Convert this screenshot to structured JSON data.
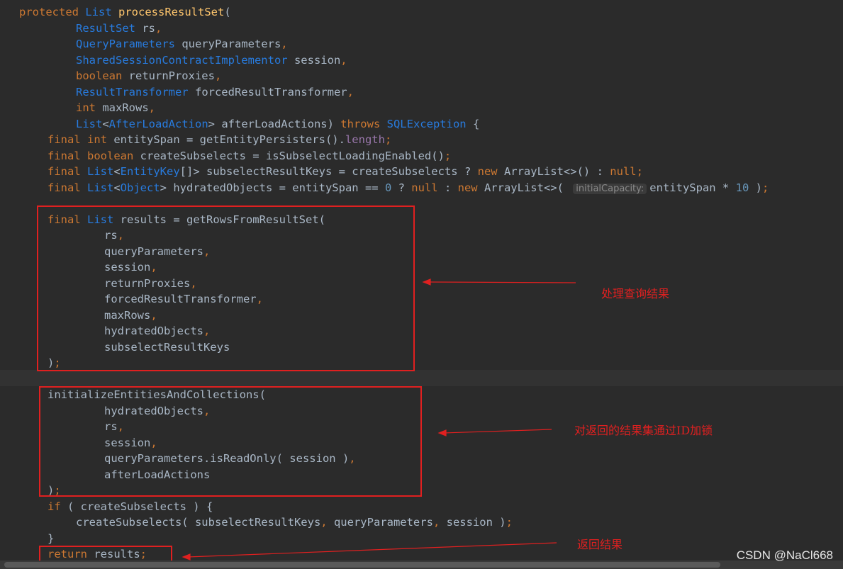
{
  "code": {
    "lines": [
      {
        "indent": 0,
        "tokens": [
          {
            "t": "protected ",
            "c": "kw"
          },
          {
            "t": "List ",
            "c": "ty"
          },
          {
            "t": "processResultSet",
            "c": "fn"
          },
          {
            "t": "(",
            "c": ""
          }
        ]
      },
      {
        "indent": 4,
        "tokens": [
          {
            "t": "ResultSet ",
            "c": "ty"
          },
          {
            "t": "rs",
            "c": ""
          },
          {
            "t": ",",
            "c": "kw"
          }
        ]
      },
      {
        "indent": 4,
        "tokens": [
          {
            "t": "QueryParameters ",
            "c": "ty"
          },
          {
            "t": "queryParameters",
            "c": ""
          },
          {
            "t": ",",
            "c": "kw"
          }
        ]
      },
      {
        "indent": 4,
        "tokens": [
          {
            "t": "SharedSessionContractImplementor ",
            "c": "ty"
          },
          {
            "t": "session",
            "c": ""
          },
          {
            "t": ",",
            "c": "kw"
          }
        ]
      },
      {
        "indent": 4,
        "tokens": [
          {
            "t": "boolean ",
            "c": "kw"
          },
          {
            "t": "returnProxies",
            "c": ""
          },
          {
            "t": ",",
            "c": "kw"
          }
        ]
      },
      {
        "indent": 4,
        "tokens": [
          {
            "t": "ResultTransformer ",
            "c": "ty"
          },
          {
            "t": "forcedResultTransformer",
            "c": ""
          },
          {
            "t": ",",
            "c": "kw"
          }
        ]
      },
      {
        "indent": 4,
        "tokens": [
          {
            "t": "int ",
            "c": "kw"
          },
          {
            "t": "maxRows",
            "c": ""
          },
          {
            "t": ",",
            "c": "kw"
          }
        ]
      },
      {
        "indent": 4,
        "tokens": [
          {
            "t": "List",
            "c": "ty"
          },
          {
            "t": "<",
            "c": ""
          },
          {
            "t": "AfterLoadAction",
            "c": "ty"
          },
          {
            "t": "> afterLoadActions) ",
            "c": ""
          },
          {
            "t": "throws ",
            "c": "kw"
          },
          {
            "t": "SQLException ",
            "c": "ty"
          },
          {
            "t": "{",
            "c": ""
          }
        ]
      },
      {
        "indent": 2,
        "tokens": [
          {
            "t": "final int ",
            "c": "kw"
          },
          {
            "t": "entitySpan = getEntityPersisters().",
            "c": ""
          },
          {
            "t": "length",
            "c": "fld"
          },
          {
            "t": ";",
            "c": "kw"
          }
        ]
      },
      {
        "indent": 2,
        "tokens": [
          {
            "t": "final boolean ",
            "c": "kw"
          },
          {
            "t": "createSubselects = isSubselectLoadingEnabled()",
            "c": ""
          },
          {
            "t": ";",
            "c": "kw"
          }
        ]
      },
      {
        "indent": 2,
        "tokens": [
          {
            "t": "final ",
            "c": "kw"
          },
          {
            "t": "List",
            "c": "ty"
          },
          {
            "t": "<",
            "c": ""
          },
          {
            "t": "EntityKey",
            "c": "ty"
          },
          {
            "t": "[]> subselectResultKeys = createSubselects ? ",
            "c": ""
          },
          {
            "t": "new ",
            "c": "kw"
          },
          {
            "t": "ArrayList<>() : ",
            "c": ""
          },
          {
            "t": "null",
            "c": "kw"
          },
          {
            "t": ";",
            "c": "kw"
          }
        ]
      },
      {
        "indent": 2,
        "tokens": [
          {
            "t": "final ",
            "c": "kw"
          },
          {
            "t": "List",
            "c": "ty"
          },
          {
            "t": "<",
            "c": ""
          },
          {
            "t": "Object",
            "c": "ty"
          },
          {
            "t": "> hydratedObjects = entitySpan == ",
            "c": ""
          },
          {
            "t": "0",
            "c": "num"
          },
          {
            "t": " ? ",
            "c": ""
          },
          {
            "t": "null",
            "c": "kw"
          },
          {
            "t": " : ",
            "c": ""
          },
          {
            "t": "new ",
            "c": "kw"
          },
          {
            "t": "ArrayList<>( ",
            "c": ""
          },
          {
            "t": "initialCapacity:",
            "c": "hint"
          },
          {
            "t": "entitySpan * ",
            "c": ""
          },
          {
            "t": "10",
            "c": "num"
          },
          {
            "t": " )",
            "c": ""
          },
          {
            "t": ";",
            "c": "kw"
          }
        ]
      },
      {
        "indent": 0,
        "tokens": []
      },
      {
        "indent": 2,
        "tokens": [
          {
            "t": "final ",
            "c": "kw"
          },
          {
            "t": "List ",
            "c": "ty"
          },
          {
            "t": "results = getRowsFromResultSet(",
            "c": ""
          }
        ]
      },
      {
        "indent": 6,
        "tokens": [
          {
            "t": "rs",
            "c": ""
          },
          {
            "t": ",",
            "c": "kw"
          }
        ]
      },
      {
        "indent": 6,
        "tokens": [
          {
            "t": "queryParameters",
            "c": ""
          },
          {
            "t": ",",
            "c": "kw"
          }
        ]
      },
      {
        "indent": 6,
        "tokens": [
          {
            "t": "session",
            "c": ""
          },
          {
            "t": ",",
            "c": "kw"
          }
        ]
      },
      {
        "indent": 6,
        "tokens": [
          {
            "t": "returnProxies",
            "c": ""
          },
          {
            "t": ",",
            "c": "kw"
          }
        ]
      },
      {
        "indent": 6,
        "tokens": [
          {
            "t": "forcedResultTransformer",
            "c": ""
          },
          {
            "t": ",",
            "c": "kw"
          }
        ]
      },
      {
        "indent": 6,
        "tokens": [
          {
            "t": "maxRows",
            "c": ""
          },
          {
            "t": ",",
            "c": "kw"
          }
        ]
      },
      {
        "indent": 6,
        "tokens": [
          {
            "t": "hydratedObjects",
            "c": ""
          },
          {
            "t": ",",
            "c": "kw"
          }
        ]
      },
      {
        "indent": 6,
        "tokens": [
          {
            "t": "subselectResultKeys",
            "c": ""
          }
        ]
      },
      {
        "indent": 2,
        "tokens": [
          {
            "t": ")",
            "c": ""
          },
          {
            "t": ";",
            "c": "kw"
          }
        ]
      },
      {
        "indent": 0,
        "tokens": []
      },
      {
        "indent": 2,
        "tokens": [
          {
            "t": "initializeEntitiesAndCollections(",
            "c": ""
          }
        ]
      },
      {
        "indent": 6,
        "tokens": [
          {
            "t": "hydratedObjects",
            "c": ""
          },
          {
            "t": ",",
            "c": "kw"
          }
        ]
      },
      {
        "indent": 6,
        "tokens": [
          {
            "t": "rs",
            "c": ""
          },
          {
            "t": ",",
            "c": "kw"
          }
        ]
      },
      {
        "indent": 6,
        "tokens": [
          {
            "t": "session",
            "c": ""
          },
          {
            "t": ",",
            "c": "kw"
          }
        ]
      },
      {
        "indent": 6,
        "tokens": [
          {
            "t": "queryParameters.isReadOnly( session )",
            "c": ""
          },
          {
            "t": ",",
            "c": "kw"
          }
        ]
      },
      {
        "indent": 6,
        "tokens": [
          {
            "t": "afterLoadActions",
            "c": ""
          }
        ]
      },
      {
        "indent": 2,
        "tokens": [
          {
            "t": ")",
            "c": ""
          },
          {
            "t": ";",
            "c": "kw"
          }
        ]
      },
      {
        "indent": 2,
        "tokens": [
          {
            "t": "if ",
            "c": "kw"
          },
          {
            "t": "( createSubselects ) {",
            "c": ""
          }
        ]
      },
      {
        "indent": 4,
        "tokens": [
          {
            "t": "createSubselects( subselectResultKeys",
            "c": ""
          },
          {
            "t": ", ",
            "c": "kw"
          },
          {
            "t": "queryParameters",
            "c": ""
          },
          {
            "t": ", ",
            "c": "kw"
          },
          {
            "t": "session )",
            "c": ""
          },
          {
            "t": ";",
            "c": "kw"
          }
        ]
      },
      {
        "indent": 2,
        "tokens": [
          {
            "t": "}",
            "c": ""
          }
        ]
      },
      {
        "indent": 2,
        "tokens": [
          {
            "t": "return ",
            "c": "kw"
          },
          {
            "t": "results",
            "c": ""
          },
          {
            "t": ";",
            "c": "kw"
          }
        ]
      }
    ]
  },
  "annotations": {
    "process_results": "处理查询结果",
    "lock_by_id": "对返回的结果集通过ID加锁",
    "return_results": "返回结果"
  },
  "watermark": "CSDN @NaCl668",
  "colors": {
    "background": "#2b2b2b",
    "annotation_red": "#e02020",
    "keyword": "#cc7832",
    "type": "#287bde",
    "method": "#ffc66d",
    "number": "#6897bb",
    "field": "#9876aa",
    "text": "#a9b7c6"
  }
}
